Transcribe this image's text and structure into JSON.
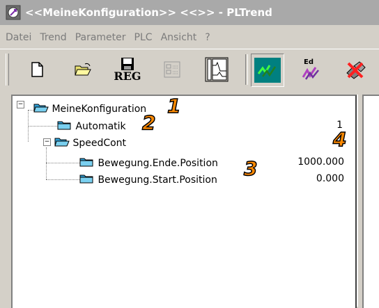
{
  "window": {
    "title": "<<MeineKonfiguration>> <<>> - PLTrend"
  },
  "menu": [
    "Datei",
    "Trend",
    "Parameter",
    "PLC",
    "Ansicht",
    "?"
  ],
  "toolbar": {
    "reg_label": "REG",
    "ed_label": "Ed"
  },
  "tree": {
    "root": "MeineKonfiguration",
    "automatik": {
      "label": "Automatik",
      "value": "1"
    },
    "speedcont": "SpeedCont",
    "ende": {
      "label": "Bewegung.Ende.Position",
      "value": "1000.000"
    },
    "start": {
      "label": "Bewegung.Start.Position",
      "value": "0.000"
    }
  },
  "callouts": [
    "1",
    "2",
    "3",
    "4"
  ],
  "colors": {
    "callout": "#ff8a00",
    "folder": "#2ea0d8",
    "title_bar": "#a9a9a9"
  }
}
